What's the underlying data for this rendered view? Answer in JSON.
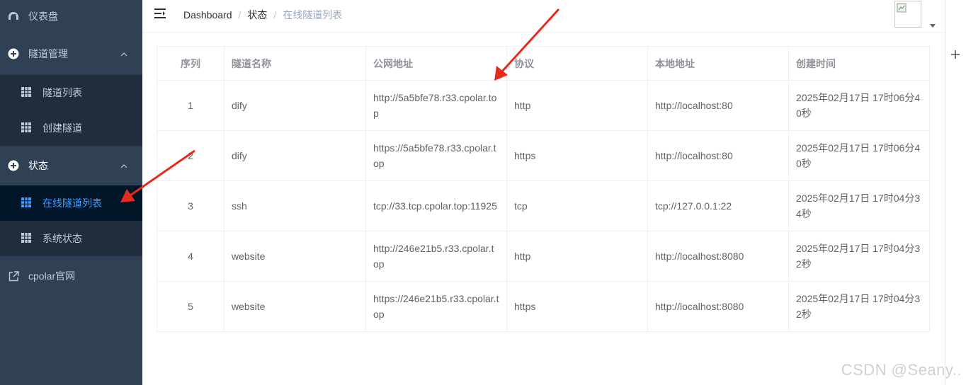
{
  "sidebar": {
    "dashboard": {
      "label": "仪表盘",
      "icon": "dashboard-icon"
    },
    "tunnel_mgmt": {
      "label": "隧道管理",
      "icon": "plus-circle-icon",
      "children": [
        {
          "label": "隧道列表",
          "icon": "grid-icon"
        },
        {
          "label": "创建隧道",
          "icon": "grid-icon"
        }
      ]
    },
    "status": {
      "label": "状态",
      "icon": "plus-circle-icon",
      "children": [
        {
          "label": "在线隧道列表",
          "icon": "grid-icon",
          "active": true
        },
        {
          "label": "系统状态",
          "icon": "grid-icon"
        }
      ]
    },
    "website": {
      "label": "cpolar官网",
      "icon": "external-link-icon"
    }
  },
  "header": {
    "breadcrumb": [
      "Dashboard",
      "状态",
      "在线隧道列表"
    ],
    "breadcrumb_separator": "/"
  },
  "table": {
    "columns": [
      "序列",
      "隧道名称",
      "公网地址",
      "协议",
      "本地地址",
      "创建时间"
    ],
    "rows": [
      [
        "1",
        "dify",
        "http://5a5bfe78.r33.cpolar.top",
        "http",
        "http://localhost:80",
        "2025年02月17日 17时06分40秒"
      ],
      [
        "2",
        "dify",
        "https://5a5bfe78.r33.cpolar.top",
        "https",
        "http://localhost:80",
        "2025年02月17日 17时06分40秒"
      ],
      [
        "3",
        "ssh",
        "tcp://33.tcp.cpolar.top:11925",
        "tcp",
        "tcp://127.0.0.1:22",
        "2025年02月17日 17时04分34秒"
      ],
      [
        "4",
        "website",
        "http://246e21b5.r33.cpolar.top",
        "http",
        "http://localhost:8080",
        "2025年02月17日 17时04分32秒"
      ],
      [
        "5",
        "website",
        "https://246e21b5.r33.cpolar.top",
        "https",
        "http://localhost:8080",
        "2025年02月17日 17时04分32秒"
      ]
    ]
  },
  "watermark": "CSDN @Seany..",
  "colors": {
    "sidebar_bg": "#304156",
    "submenu_bg": "#1f2d3d",
    "active_item_bg": "#001528",
    "accent": "#409eff",
    "annotation_arrow": "#e8291c"
  }
}
